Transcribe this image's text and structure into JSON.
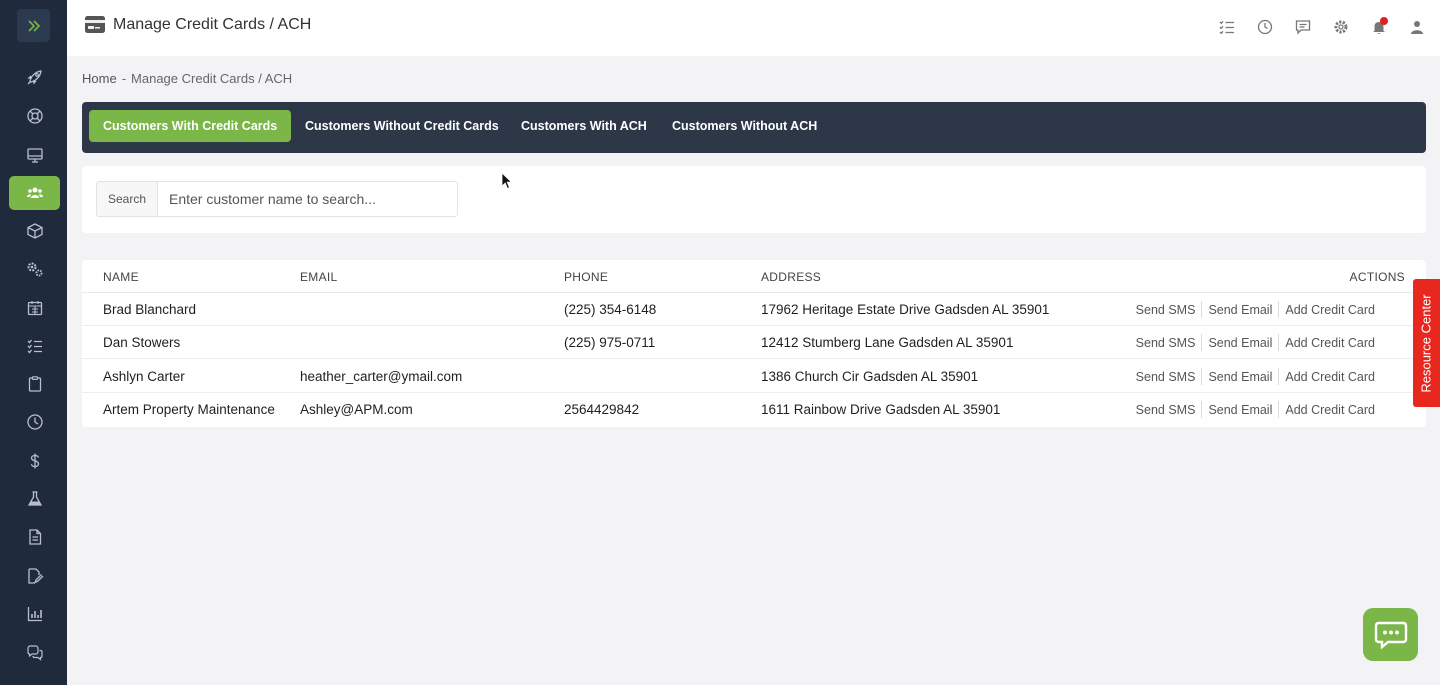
{
  "header": {
    "title": "Manage Credit Cards / ACH"
  },
  "breadcrumb": {
    "home": "Home",
    "separator": "-",
    "current": "Manage Credit Cards / ACH"
  },
  "tabs": [
    {
      "label": "Customers With Credit Cards",
      "active": true
    },
    {
      "label": "Customers Without Credit Cards",
      "active": false
    },
    {
      "label": "Customers With ACH",
      "active": false
    },
    {
      "label": "Customers Without ACH",
      "active": false
    }
  ],
  "search": {
    "label": "Search",
    "placeholder": "Enter customer name to search...",
    "value": ""
  },
  "table": {
    "headers": {
      "name": "NAME",
      "email": "EMAIL",
      "phone": "PHONE",
      "address": "ADDRESS",
      "actions": "ACTIONS"
    },
    "rows": [
      {
        "name": "Brad Blanchard",
        "email": "",
        "phone": "(225) 354-6148",
        "address": "17962 Heritage Estate Drive Gadsden AL 35901"
      },
      {
        "name": "Dan Stowers",
        "email": "",
        "phone": "(225) 975-0711",
        "address": "12412 Stumberg Lane Gadsden AL 35901"
      },
      {
        "name": "Ashlyn Carter",
        "email": "heather_carter@ymail.com",
        "phone": "",
        "address": "1386 Church Cir Gadsden AL 35901"
      },
      {
        "name": "Artem Property Maintenance",
        "email": "Ashley@APM.com",
        "phone": "2564429842",
        "address": "1611 Rainbow Drive Gadsden AL 35901"
      }
    ],
    "actions": {
      "send_sms": "Send SMS",
      "send_email": "Send Email",
      "add_credit_card": "Add Credit Card"
    }
  },
  "resource_center": {
    "label": "Resource Center"
  },
  "colors": {
    "sidebar": "#1f2a3c",
    "accent_green": "#7ab648",
    "tabbar": "#2d3748",
    "resource_red": "#e8271f"
  },
  "icons": {
    "sidebar": [
      "rocket-icon",
      "lifebuoy-icon",
      "monitor-icon",
      "users-icon",
      "box-icon",
      "gears-icon",
      "calendar-icon",
      "checklist-icon",
      "clipboard-icon",
      "clock-icon",
      "dollar-icon",
      "flask-icon",
      "document-icon",
      "signature-icon",
      "chart-icon",
      "chat-icon"
    ],
    "header": [
      "checklist-icon",
      "clock-icon",
      "message-icon",
      "gear-icon",
      "bell-icon",
      "user-icon"
    ]
  }
}
